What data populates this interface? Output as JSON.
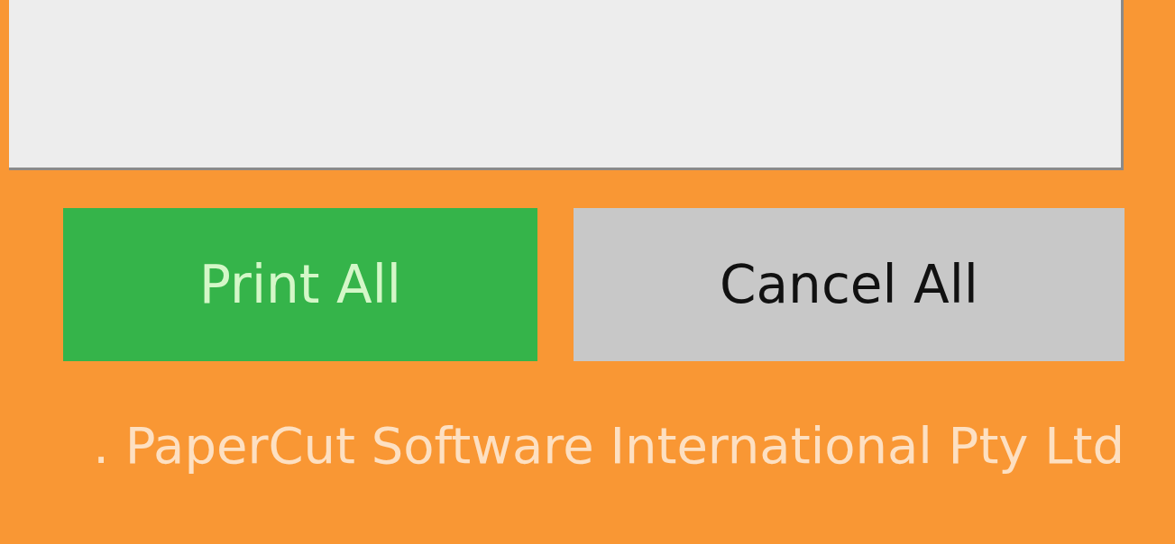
{
  "panel": {
    "kind": "empty"
  },
  "buttons": [
    {
      "label": "Print All",
      "kind": "primary"
    },
    {
      "label": "Cancel All",
      "kind": "secondary"
    }
  ],
  "footer": ". PaperCut Software International Pty Ltd"
}
